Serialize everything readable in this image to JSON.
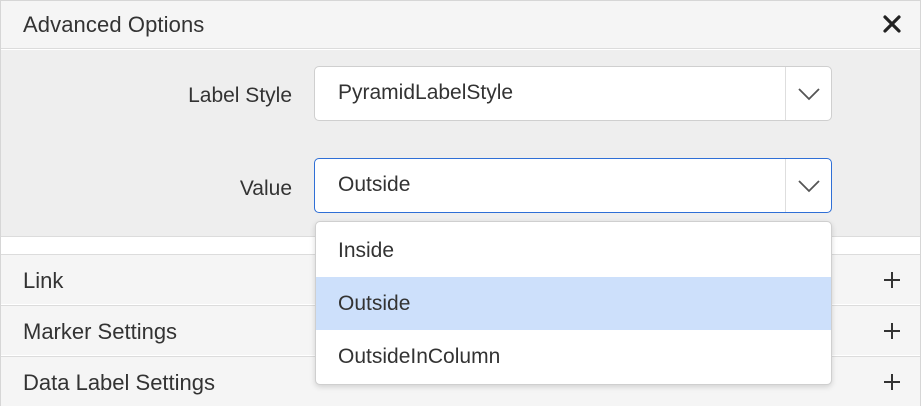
{
  "advanced_options": {
    "title": "Advanced Options",
    "close_icon": "close-icon",
    "fields": {
      "label_style": {
        "label": "Label Style",
        "value": "PyramidLabelStyle"
      },
      "value": {
        "label": "Value",
        "value": "Outside"
      }
    }
  },
  "dropdown": {
    "options": [
      "Inside",
      "Outside",
      "OutsideInColumn"
    ],
    "selected": "Outside"
  },
  "sections": [
    {
      "label": "Link",
      "icon": "plus-icon"
    },
    {
      "label": "Marker Settings",
      "icon": "plus-icon"
    },
    {
      "label": "Data Label Settings",
      "icon": "plus-icon"
    }
  ],
  "colors": {
    "focus_border": "#2f6fd6",
    "selected_bg": "#cde0fb",
    "header_bg": "#f5f5f5",
    "body_bg": "#eeeeee"
  }
}
